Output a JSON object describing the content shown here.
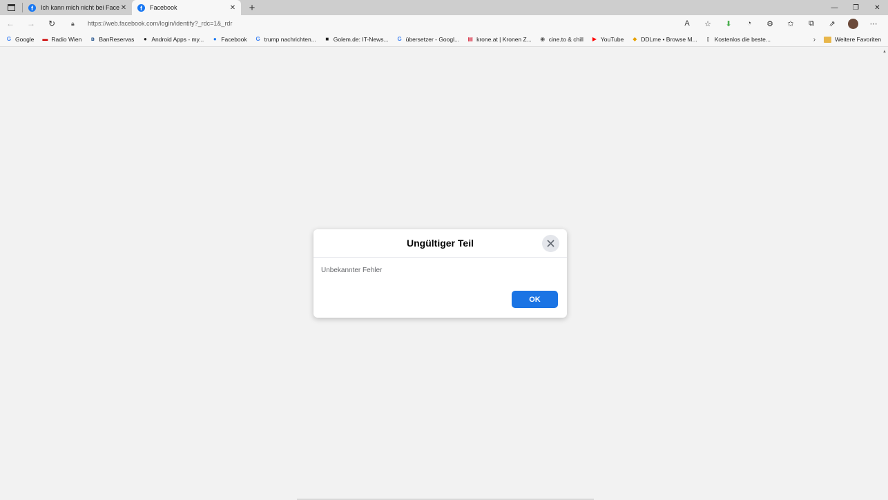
{
  "tabs": [
    {
      "title": "Ich kann mich nicht bei Facebook",
      "active": false
    },
    {
      "title": "Facebook",
      "active": true
    }
  ],
  "address": {
    "url": "https://web.facebook.com/login/identify?_rdc=1&_rdr"
  },
  "bookmarks": [
    {
      "label": "Google",
      "icon": "google-icon"
    },
    {
      "label": "Radio Wien",
      "icon": "orf-icon"
    },
    {
      "label": "BanReservas",
      "icon": "banreservas-icon"
    },
    {
      "label": "Android Apps - my...",
      "icon": "android-apps-icon"
    },
    {
      "label": "Facebook",
      "icon": "facebook-icon"
    },
    {
      "label": "trump nachrichten...",
      "icon": "google-icon"
    },
    {
      "label": "Golem.de: IT-News...",
      "icon": "golem-icon"
    },
    {
      "label": "übersetzer - Googl...",
      "icon": "google-icon"
    },
    {
      "label": "krone.at | Kronen Z...",
      "icon": "krone-icon"
    },
    {
      "label": "cine.to & chill",
      "icon": "cine-icon"
    },
    {
      "label": "YouTube",
      "icon": "youtube-icon"
    },
    {
      "label": "DDLme • Browse M...",
      "icon": "ddlme-icon"
    },
    {
      "label": "Kostenlos die beste...",
      "icon": "page-icon"
    }
  ],
  "bookmarks_more": "Weitere Favoriten",
  "dialog": {
    "title": "Ungültiger Teil",
    "message": "Unbekannter Fehler",
    "ok_label": "OK"
  }
}
